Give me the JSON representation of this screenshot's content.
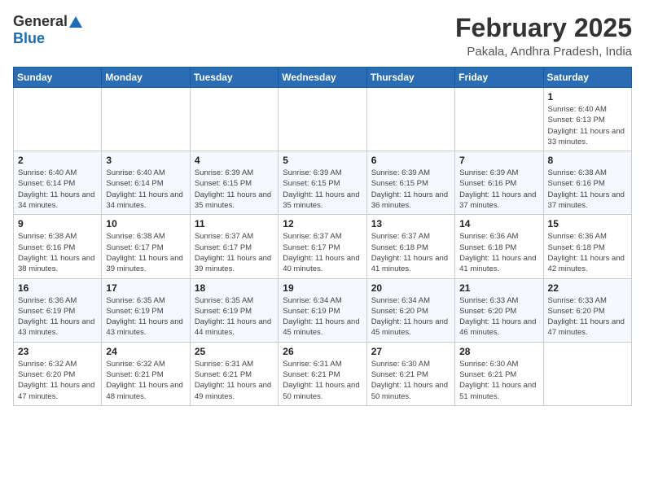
{
  "header": {
    "logo_general": "General",
    "logo_blue": "Blue",
    "month_year": "February 2025",
    "location": "Pakala, Andhra Pradesh, India"
  },
  "weekdays": [
    "Sunday",
    "Monday",
    "Tuesday",
    "Wednesday",
    "Thursday",
    "Friday",
    "Saturday"
  ],
  "weeks": [
    [
      {
        "day": "",
        "info": ""
      },
      {
        "day": "",
        "info": ""
      },
      {
        "day": "",
        "info": ""
      },
      {
        "day": "",
        "info": ""
      },
      {
        "day": "",
        "info": ""
      },
      {
        "day": "",
        "info": ""
      },
      {
        "day": "1",
        "info": "Sunrise: 6:40 AM\nSunset: 6:13 PM\nDaylight: 11 hours and 33 minutes."
      }
    ],
    [
      {
        "day": "2",
        "info": "Sunrise: 6:40 AM\nSunset: 6:14 PM\nDaylight: 11 hours and 34 minutes."
      },
      {
        "day": "3",
        "info": "Sunrise: 6:40 AM\nSunset: 6:14 PM\nDaylight: 11 hours and 34 minutes."
      },
      {
        "day": "4",
        "info": "Sunrise: 6:39 AM\nSunset: 6:15 PM\nDaylight: 11 hours and 35 minutes."
      },
      {
        "day": "5",
        "info": "Sunrise: 6:39 AM\nSunset: 6:15 PM\nDaylight: 11 hours and 35 minutes."
      },
      {
        "day": "6",
        "info": "Sunrise: 6:39 AM\nSunset: 6:15 PM\nDaylight: 11 hours and 36 minutes."
      },
      {
        "day": "7",
        "info": "Sunrise: 6:39 AM\nSunset: 6:16 PM\nDaylight: 11 hours and 37 minutes."
      },
      {
        "day": "8",
        "info": "Sunrise: 6:38 AM\nSunset: 6:16 PM\nDaylight: 11 hours and 37 minutes."
      }
    ],
    [
      {
        "day": "9",
        "info": "Sunrise: 6:38 AM\nSunset: 6:16 PM\nDaylight: 11 hours and 38 minutes."
      },
      {
        "day": "10",
        "info": "Sunrise: 6:38 AM\nSunset: 6:17 PM\nDaylight: 11 hours and 39 minutes."
      },
      {
        "day": "11",
        "info": "Sunrise: 6:37 AM\nSunset: 6:17 PM\nDaylight: 11 hours and 39 minutes."
      },
      {
        "day": "12",
        "info": "Sunrise: 6:37 AM\nSunset: 6:17 PM\nDaylight: 11 hours and 40 minutes."
      },
      {
        "day": "13",
        "info": "Sunrise: 6:37 AM\nSunset: 6:18 PM\nDaylight: 11 hours and 41 minutes."
      },
      {
        "day": "14",
        "info": "Sunrise: 6:36 AM\nSunset: 6:18 PM\nDaylight: 11 hours and 41 minutes."
      },
      {
        "day": "15",
        "info": "Sunrise: 6:36 AM\nSunset: 6:18 PM\nDaylight: 11 hours and 42 minutes."
      }
    ],
    [
      {
        "day": "16",
        "info": "Sunrise: 6:36 AM\nSunset: 6:19 PM\nDaylight: 11 hours and 43 minutes."
      },
      {
        "day": "17",
        "info": "Sunrise: 6:35 AM\nSunset: 6:19 PM\nDaylight: 11 hours and 43 minutes."
      },
      {
        "day": "18",
        "info": "Sunrise: 6:35 AM\nSunset: 6:19 PM\nDaylight: 11 hours and 44 minutes."
      },
      {
        "day": "19",
        "info": "Sunrise: 6:34 AM\nSunset: 6:19 PM\nDaylight: 11 hours and 45 minutes."
      },
      {
        "day": "20",
        "info": "Sunrise: 6:34 AM\nSunset: 6:20 PM\nDaylight: 11 hours and 45 minutes."
      },
      {
        "day": "21",
        "info": "Sunrise: 6:33 AM\nSunset: 6:20 PM\nDaylight: 11 hours and 46 minutes."
      },
      {
        "day": "22",
        "info": "Sunrise: 6:33 AM\nSunset: 6:20 PM\nDaylight: 11 hours and 47 minutes."
      }
    ],
    [
      {
        "day": "23",
        "info": "Sunrise: 6:32 AM\nSunset: 6:20 PM\nDaylight: 11 hours and 47 minutes."
      },
      {
        "day": "24",
        "info": "Sunrise: 6:32 AM\nSunset: 6:21 PM\nDaylight: 11 hours and 48 minutes."
      },
      {
        "day": "25",
        "info": "Sunrise: 6:31 AM\nSunset: 6:21 PM\nDaylight: 11 hours and 49 minutes."
      },
      {
        "day": "26",
        "info": "Sunrise: 6:31 AM\nSunset: 6:21 PM\nDaylight: 11 hours and 50 minutes."
      },
      {
        "day": "27",
        "info": "Sunrise: 6:30 AM\nSunset: 6:21 PM\nDaylight: 11 hours and 50 minutes."
      },
      {
        "day": "28",
        "info": "Sunrise: 6:30 AM\nSunset: 6:21 PM\nDaylight: 11 hours and 51 minutes."
      },
      {
        "day": "",
        "info": ""
      }
    ]
  ]
}
